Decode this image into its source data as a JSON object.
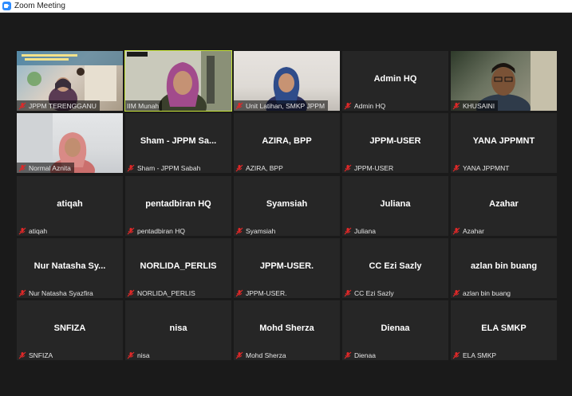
{
  "window": {
    "title": "Zoom Meeting"
  },
  "colors": {
    "active_speaker": "#c7e43a",
    "mic_muted": "#e02828"
  },
  "participants": [
    {
      "display": "",
      "label": "JPPM TERENGGANU",
      "video": true
    },
    {
      "display": "",
      "label": "IIM Munah",
      "video": true,
      "active": true
    },
    {
      "display": "",
      "label": "Unit Latihan, SMKP JPPM",
      "video": true
    },
    {
      "display": "Admin HQ",
      "label": "Admin HQ",
      "video": false
    },
    {
      "display": "",
      "label": "KHUSAINI",
      "video": true
    },
    {
      "display": "",
      "label": "Normal Aznita",
      "video": true
    },
    {
      "display": "Sham - JPPM Sa...",
      "label": "Sham - JPPM Sabah",
      "video": false
    },
    {
      "display": "AZIRA, BPP",
      "label": "AZIRA, BPP",
      "video": false
    },
    {
      "display": "JPPM-USER",
      "label": "JPPM-USER",
      "video": false
    },
    {
      "display": "YANA JPPMNT",
      "label": "YANA JPPMNT",
      "video": false
    },
    {
      "display": "atiqah",
      "label": "atiqah",
      "video": false
    },
    {
      "display": "pentadbiran HQ",
      "label": "pentadbiran HQ",
      "video": false
    },
    {
      "display": "Syamsiah",
      "label": "Syamsiah",
      "video": false
    },
    {
      "display": "Juliana",
      "label": "Juliana",
      "video": false
    },
    {
      "display": "Azahar",
      "label": "Azahar",
      "video": false
    },
    {
      "display": "Nur Natasha Sy...",
      "label": "Nur Natasha Syazfira",
      "video": false
    },
    {
      "display": "NORLIDA_PERLIS",
      "label": "NORLIDA_PERLIS",
      "video": false
    },
    {
      "display": "JPPM-USER.",
      "label": "JPPM-USER.",
      "video": false
    },
    {
      "display": "CC Ezi Sazly",
      "label": "CC Ezi Sazly",
      "video": false
    },
    {
      "display": "azlan bin buang",
      "label": "azlan bin buang",
      "video": false
    },
    {
      "display": "SNFIZA",
      "label": "SNFIZA",
      "video": false
    },
    {
      "display": "nisa",
      "label": "nisa",
      "video": false
    },
    {
      "display": "Mohd Sherza",
      "label": "Mohd Sherza",
      "video": false
    },
    {
      "display": "Dienaa",
      "label": "Dienaa",
      "video": false
    },
    {
      "display": "ELA SMKP",
      "label": "ELA SMKP",
      "video": false
    }
  ],
  "icons": {
    "muted": "mic-muted-icon",
    "app": "zoom-app-icon"
  }
}
